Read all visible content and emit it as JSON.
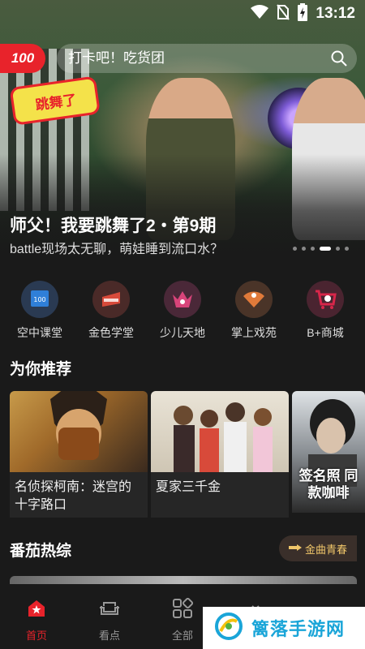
{
  "status_bar": {
    "time": "13:12"
  },
  "search": {
    "logo_text": "100",
    "placeholder": "打卡吧！吃货团"
  },
  "hero": {
    "title": "师父！我要跳舞了2・第9期",
    "subtitle": "battle现场太无聊，萌娃睡到流口水？",
    "logo_text": "师父！我要跳舞了",
    "carousel_total": 6,
    "carousel_active": 4
  },
  "categories": [
    {
      "label": "空中课堂",
      "icon": "classroom-icon",
      "color": "#2f7fd8"
    },
    {
      "label": "金色学堂",
      "icon": "golden-school-icon",
      "color": "#d84a3a"
    },
    {
      "label": "少儿天地",
      "icon": "kids-icon",
      "color": "#d8447a"
    },
    {
      "label": "掌上戏苑",
      "icon": "opera-fan-icon",
      "color": "#e07a3a"
    },
    {
      "label": "B+商城",
      "icon": "shopping-cart-icon",
      "color": "#d8264a"
    }
  ],
  "recommend": {
    "title": "为你推荐",
    "items": [
      {
        "title": "名侦探柯南：迷宫的十字路口"
      },
      {
        "title": "夏家三千金"
      },
      {
        "overlay": "签名照 同款咖啡"
      }
    ]
  },
  "variety": {
    "title": "番茄热综",
    "tag": "金曲青春"
  },
  "nav": [
    {
      "label": "首页",
      "icon": "home-icon",
      "active": true
    },
    {
      "label": "看点",
      "icon": "sofa-icon",
      "active": false
    },
    {
      "label": "全部",
      "icon": "grid-icon",
      "active": false
    },
    {
      "label": "",
      "icon": "tv-icon",
      "active": false
    },
    {
      "label": "",
      "icon": "message-icon",
      "active": false
    }
  ],
  "watermark": {
    "text": "篱落手游网"
  }
}
